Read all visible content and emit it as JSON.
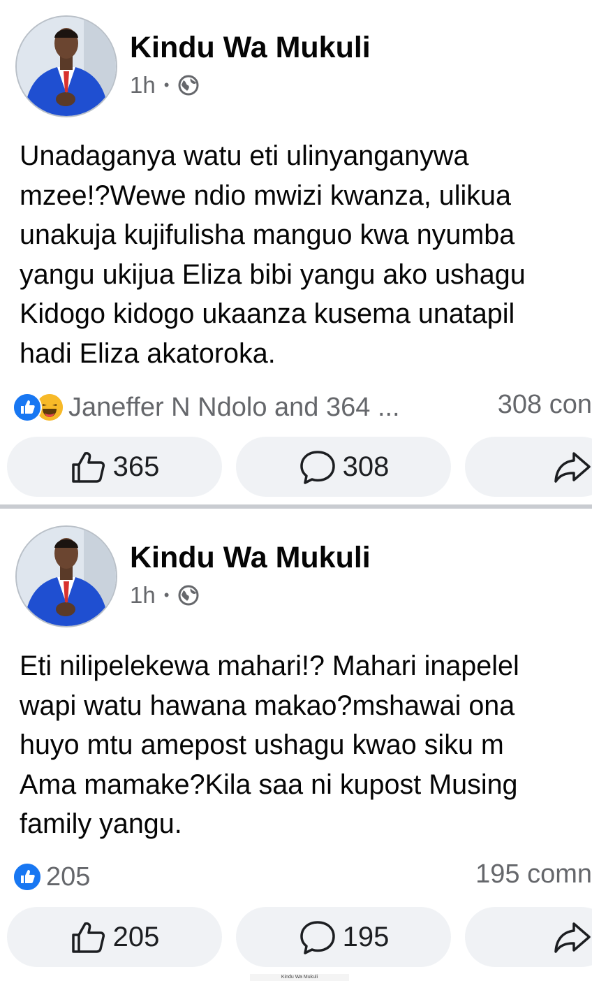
{
  "colors": {
    "brand_blue": "#1877f2",
    "haha_yellow": "#f7b928",
    "meta_gray": "#65676b",
    "pill_bg": "#f0f2f5"
  },
  "posts": [
    {
      "author": "Kindu Wa Mukuli",
      "time": "1h",
      "separator": "•",
      "privacy_icon": "globe-icon",
      "text_lines": [
        "Unadaganya watu eti ulinyanganywa",
        "mzee!?Wewe ndio mwizi kwanza, ulikua",
        "unakuja kujifulisha manguo kwa nyumba",
        "yangu ukijua Eliza bibi yangu ako ushagu",
        "Kidogo kidogo ukaanza kusema unatapil",
        "hadi Eliza akatoroka."
      ],
      "reaction_icons": [
        "like-icon",
        "haha-icon"
      ],
      "reactions_text": "Janeffer N Ndolo and 364 ...",
      "comments_text": "308 con",
      "like_count": "365",
      "comment_count": "308"
    },
    {
      "author": "Kindu Wa Mukuli",
      "time": "1h",
      "separator": "•",
      "privacy_icon": "globe-icon",
      "text_lines": [
        "Eti nilipelekewa mahari!? Mahari inapelel",
        "wapi watu hawana makao?mshawai ona",
        "huyo mtu amepost ushagu kwao siku m",
        "Ama mamake?Kila saa ni kupost Musing",
        "family yangu."
      ],
      "reaction_icons": [
        "like-icon"
      ],
      "reactions_text": "205",
      "comments_text": "195 comn",
      "like_count": "205",
      "comment_count": "195"
    }
  ],
  "footer_fragment": "Kindu Wa Mukuli"
}
